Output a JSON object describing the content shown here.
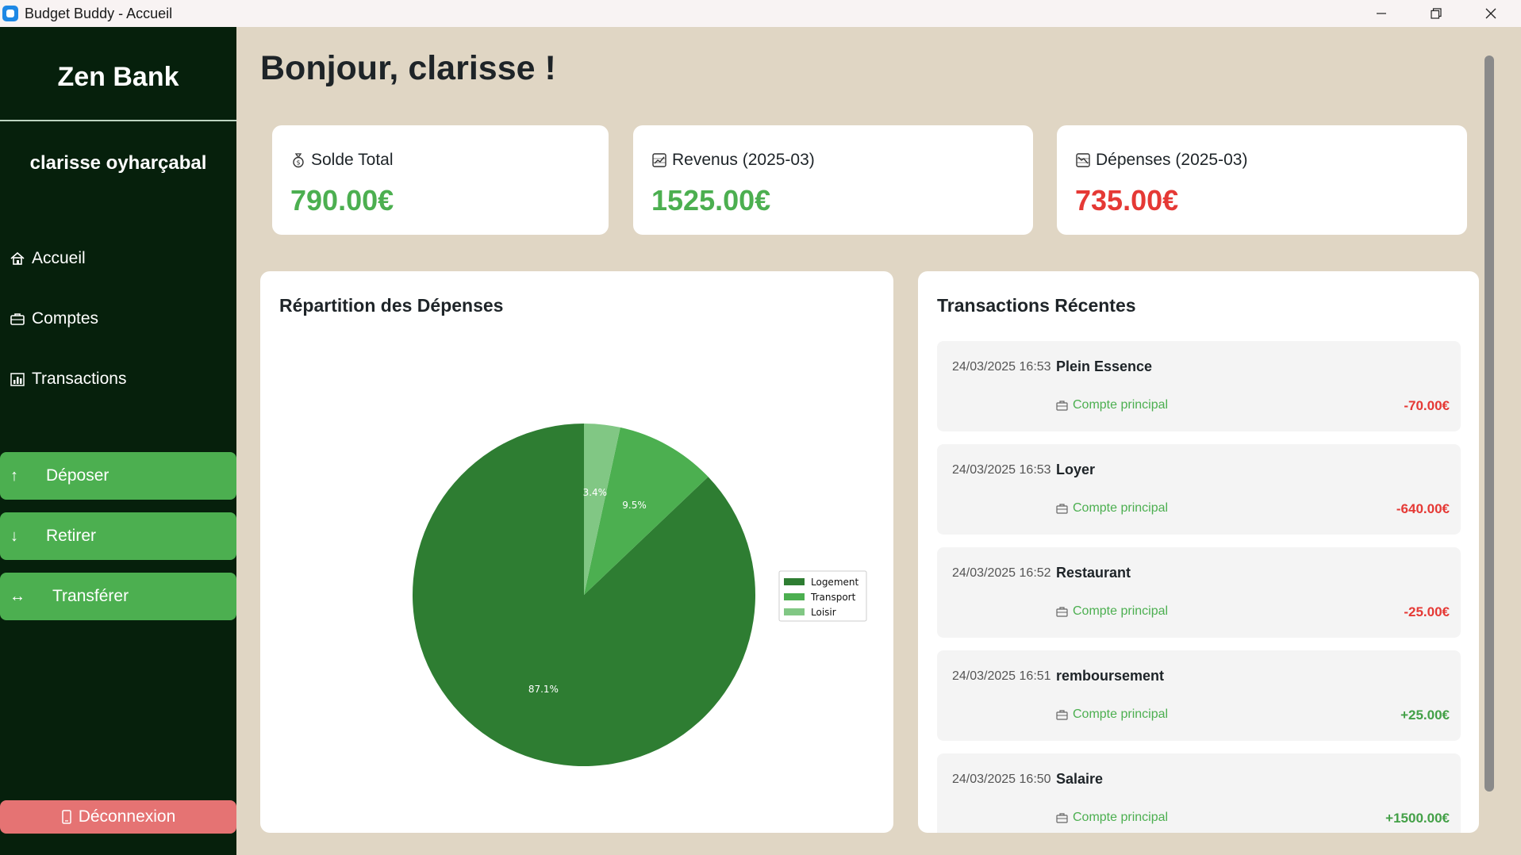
{
  "window": {
    "title": "Budget Buddy - Accueil",
    "minimize_glyph": "—",
    "close_glyph": "✕"
  },
  "sidebar": {
    "brand": "Zen Bank",
    "user": "clarisse oyharçabal",
    "nav": [
      {
        "label": "Accueil",
        "icon": "home-icon"
      },
      {
        "label": "Comptes",
        "icon": "briefcase-icon"
      },
      {
        "label": "Transactions",
        "icon": "bar-chart-icon"
      }
    ],
    "actions": [
      {
        "label": "Déposer",
        "icon": "arrow-up-icon",
        "glyph": "↑"
      },
      {
        "label": "Retirer",
        "icon": "arrow-down-icon",
        "glyph": "↓"
      },
      {
        "label": "Transférer",
        "icon": "transfer-icon",
        "glyph": "↔"
      }
    ],
    "logout": {
      "label": "Déconnexion",
      "icon": "phone-icon"
    }
  },
  "greeting": "Bonjour, clarisse !",
  "cards": [
    {
      "label": "Solde Total",
      "value": "790.00€",
      "icon": "money-bag-icon",
      "color": "#4caf50"
    },
    {
      "label": "Revenus (2025-03)",
      "value": "1525.00€",
      "icon": "chart-up-icon",
      "color": "#4caf50"
    },
    {
      "label": "Dépenses (2025-03)",
      "value": "735.00€",
      "icon": "chart-down-icon",
      "color": "#e53935"
    }
  ],
  "expenses_panel": {
    "title": "Répartition des Dépenses"
  },
  "chart_data": {
    "type": "pie",
    "title": "",
    "slices": [
      {
        "label": "Logement",
        "value": 87.1,
        "color": "#2e7d32"
      },
      {
        "label": "Transport",
        "value": 9.5,
        "color": "#4caf50"
      },
      {
        "label": "Loisir",
        "value": 3.4,
        "color": "#81c784"
      }
    ],
    "legend_position": "right"
  },
  "transactions_panel": {
    "title": "Transactions Récentes",
    "items": [
      {
        "date": "24/03/2025 16:53",
        "name": "Plein Essence",
        "account": "Compte principal",
        "amount": "-70.00€",
        "color": "#e53935"
      },
      {
        "date": "24/03/2025 16:53",
        "name": "Loyer",
        "account": "Compte principal",
        "amount": "-640.00€",
        "color": "#e53935"
      },
      {
        "date": "24/03/2025 16:52",
        "name": "Restaurant",
        "account": "Compte principal",
        "amount": "-25.00€",
        "color": "#e53935"
      },
      {
        "date": "24/03/2025 16:51",
        "name": "remboursement",
        "account": "Compte principal",
        "amount": "+25.00€",
        "color": "#43a047"
      },
      {
        "date": "24/03/2025 16:50",
        "name": "Salaire",
        "account": "Compte principal",
        "amount": "+1500.00€",
        "color": "#43a047"
      }
    ]
  }
}
